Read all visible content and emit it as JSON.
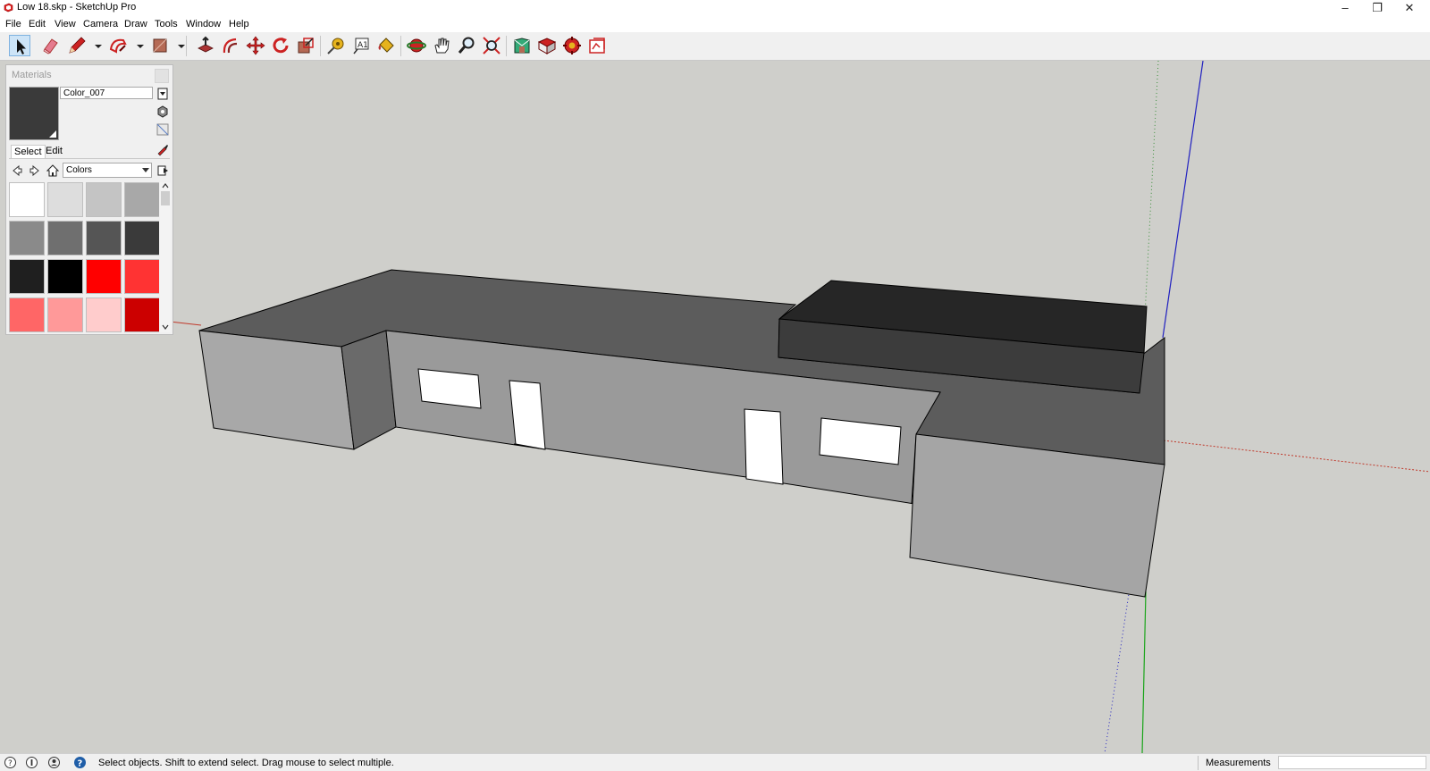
{
  "window": {
    "title": "Low 18.skp - SketchUp Pro",
    "minimize": "–",
    "restore": "❐",
    "close": "✕"
  },
  "menu": [
    "File",
    "Edit",
    "View",
    "Camera",
    "Draw",
    "Tools",
    "Window",
    "Help"
  ],
  "toolbar": {
    "tools": [
      {
        "name": "select-tool",
        "icon": "arrow-cursor-icon",
        "active": true
      },
      {
        "name": "eraser-tool",
        "icon": "eraser-icon"
      },
      {
        "name": "line-tool",
        "icon": "pencil-icon"
      },
      {
        "name": "line-tool-dropdown",
        "icon": "dropdown-arrow-icon"
      },
      {
        "name": "arc-tool",
        "icon": "arc-icon"
      },
      {
        "name": "arc-tool-dropdown",
        "icon": "dropdown-arrow-icon"
      },
      {
        "name": "shape-tool",
        "icon": "rectangle-icon"
      },
      {
        "name": "shape-tool-dropdown",
        "icon": "dropdown-arrow-icon"
      },
      {
        "name": "push-pull-tool",
        "icon": "push-pull-icon"
      },
      {
        "name": "offset-tool",
        "icon": "offset-icon"
      },
      {
        "name": "move-tool",
        "icon": "move-icon"
      },
      {
        "name": "rotate-tool",
        "icon": "rotate-icon"
      },
      {
        "name": "scale-tool",
        "icon": "scale-icon"
      },
      {
        "name": "tape-measure-tool",
        "icon": "tape-measure-icon"
      },
      {
        "name": "text-tool",
        "icon": "text-icon"
      },
      {
        "name": "paint-bucket-tool",
        "icon": "paint-bucket-icon"
      },
      {
        "name": "orbit-tool",
        "icon": "orbit-icon"
      },
      {
        "name": "pan-tool",
        "icon": "hand-icon"
      },
      {
        "name": "zoom-tool",
        "icon": "magnifier-icon"
      },
      {
        "name": "zoom-extents-tool",
        "icon": "zoom-extents-icon"
      },
      {
        "name": "warehouse-tool",
        "icon": "warehouse-icon"
      },
      {
        "name": "extension-warehouse-tool",
        "icon": "extension-icon"
      },
      {
        "name": "extension-manager-tool",
        "icon": "extension-manager-icon"
      },
      {
        "name": "send-to-layout-tool",
        "icon": "layout-icon"
      }
    ]
  },
  "materials": {
    "title": "Materials",
    "current_material": "Color_007",
    "current_color": "#3a3a3a",
    "tabs": [
      "Select",
      "Edit"
    ],
    "collection": "Colors",
    "swatches": [
      "#ffffff",
      "#dddddd",
      "#c4c4c4",
      "#a8a8a8",
      "#8a8a8a",
      "#6f6f6f",
      "#555555",
      "#3a3a3a",
      "#1f1f1f",
      "#000000",
      "#ff0000",
      "#ff3333",
      "#ff6666",
      "#ff9999",
      "#ffcccc",
      "#cc0000"
    ]
  },
  "status": {
    "hint": "Select objects. Shift to extend select. Drag mouse to select multiple.",
    "measurements_label": "Measurements",
    "measurements_value": ""
  },
  "colors": {
    "viewport_bg": "#cfcfcb",
    "roof_top": "#5a5a5a",
    "roof_block": "#262626",
    "roof_block_side": "#3c3c3c",
    "wall_light": "#9a9a9a",
    "wall_mid": "#a8a8a8",
    "wall_dark": "#6a6a6a",
    "opening": "#ffffff",
    "axis_red": "#c0392b",
    "axis_green": "#1aa51a",
    "axis_blue": "#2020c0"
  }
}
